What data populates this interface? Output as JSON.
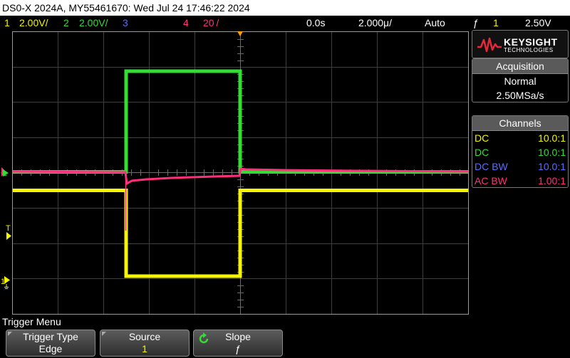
{
  "title_bar": {
    "text": "DS0-X 2024A, MY55461670: Wed Jul 24 17:46:22 2024"
  },
  "status": {
    "ch1_num": "1",
    "ch1_scale": "2.00V/",
    "ch2_num": "2",
    "ch2_scale": "2.00V/",
    "ch3_num": "3",
    "ch4_num": "4",
    "ch4_scale": "20 /",
    "time_offset": "0.0s",
    "timebase": "2.000μ/",
    "trigger_mode": "Auto",
    "trigger_edge_symbol": "ƒ",
    "trigger_source": "1",
    "trigger_level": "2.50V"
  },
  "scope": {
    "marker_labels": {
      "ch4": "4",
      "ch2": "2",
      "trigger": "T",
      "ch1": "1"
    },
    "colors": {
      "ch1": "#f5f500",
      "ch2": "#33dd33",
      "ch3": "#5b6cff",
      "ch4": "#ff2f7d",
      "trigger_marker": "#ff9a00"
    }
  },
  "brand": {
    "name": "KEYSIGHT",
    "sub": "TECHNOLOGIES"
  },
  "acquisition": {
    "header": "Acquisition",
    "mode": "Normal",
    "rate": "2.50MSa/s"
  },
  "channels": {
    "header": "Channels",
    "rows": [
      {
        "coupling": "DC",
        "probe": "10.0:1"
      },
      {
        "coupling": "DC",
        "probe": "10.0:1"
      },
      {
        "coupling": "DC BW",
        "probe": "10.0:1"
      },
      {
        "coupling": "AC BW",
        "probe": "1.00:1"
      }
    ]
  },
  "menu": {
    "title": "Trigger Menu",
    "softkeys": [
      {
        "label": "Trigger Type",
        "value": "Edge"
      },
      {
        "label": "Source",
        "value": "1"
      },
      {
        "label": "Slope",
        "value": "ƒ"
      }
    ]
  }
}
